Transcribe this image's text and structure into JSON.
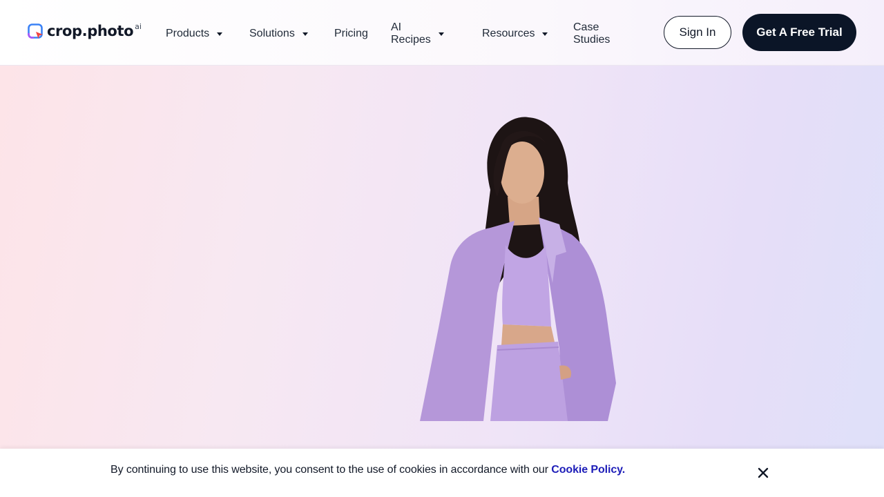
{
  "logo": {
    "text": "crop.photo",
    "sup": "ai"
  },
  "nav": [
    {
      "label": "Products",
      "dropdown": true
    },
    {
      "label": "Solutions",
      "dropdown": true
    },
    {
      "label": "Pricing",
      "dropdown": false
    },
    {
      "label": "AI Recipes",
      "dropdown": true
    },
    {
      "label": "Resources",
      "dropdown": true
    },
    {
      "label": "Case Studies",
      "dropdown": false
    }
  ],
  "header": {
    "signin_label": "Sign In",
    "trial_label": "Get A Free Trial"
  },
  "cookie": {
    "text": "By continuing to use this website, you consent to the use of cookies in accordance with our ",
    "link_label": "Cookie Policy."
  },
  "colors": {
    "dark": "#0b1527",
    "link": "#1d1db8",
    "lavender": "#b79be0"
  }
}
